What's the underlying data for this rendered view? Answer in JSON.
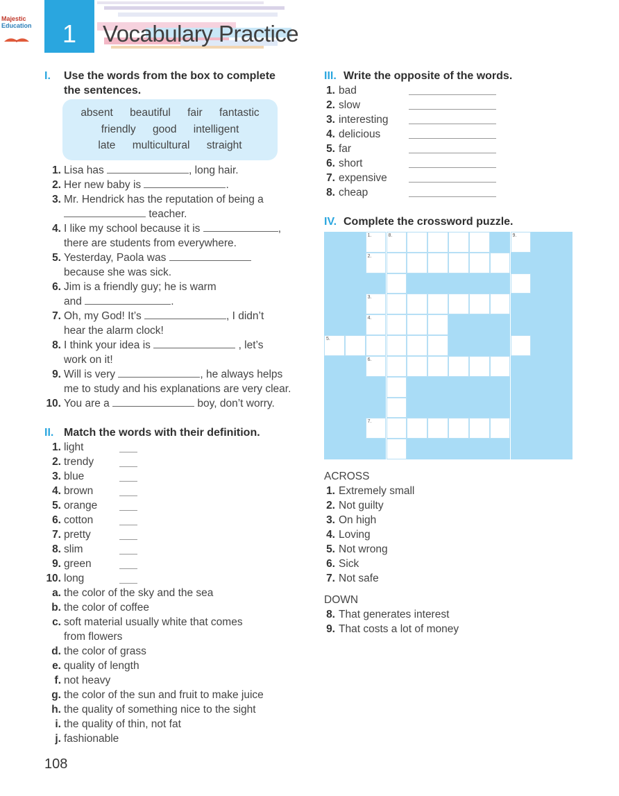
{
  "header": {
    "logo_line1": "Majestic",
    "logo_line2": "Education",
    "unit_number": "1",
    "title": "Vocabulary Practice",
    "accent_color": "#2aa6df"
  },
  "section1": {
    "roman": "I.",
    "heading": "Use the words from the box to complete the sentences.",
    "word_rows": [
      [
        "absent",
        "beautiful",
        "fair",
        "fantastic"
      ],
      [
        "friendly",
        "good",
        "intelligent"
      ],
      [
        "late",
        "multicultural",
        "straight"
      ]
    ],
    "sentences": [
      {
        "n": "1.",
        "a": "Lisa has",
        "b": ", long hair.",
        "c": ""
      },
      {
        "n": "2.",
        "a": "Her new baby is",
        "b": ".",
        "c": ""
      },
      {
        "n": "3.",
        "a": "Mr. Hendrick has the reputation of being a",
        "b": "teacher.",
        "c": ""
      },
      {
        "n": "4.",
        "a": "I like my school because it is",
        "b": ",",
        "c": "there are students from everywhere."
      },
      {
        "n": "5.",
        "a": "Yesterday, Paola was",
        "b": "",
        "c": "because she was sick."
      },
      {
        "n": "6.",
        "a": "Jim is a friendly guy; he is warm",
        "b": "and",
        "c": "."
      },
      {
        "n": "7.",
        "a": "Oh, my God! It’s",
        "b": ", I didn’t",
        "c": "hear the alarm clock!"
      },
      {
        "n": "8.",
        "a": "I think your idea is",
        "b": ", let’s",
        "c": "work on it!"
      },
      {
        "n": "9.",
        "a": "Will is very",
        "b": ", he always helps",
        "c": "me to study and his explanations are very clear."
      },
      {
        "n": "10.",
        "a": "You are a",
        "b": "boy, don’t worry.",
        "c": ""
      }
    ]
  },
  "section2": {
    "roman": "II.",
    "heading": "Match the words with their definition.",
    "words": [
      {
        "n": "1.",
        "w": "light"
      },
      {
        "n": "2.",
        "w": "trendy"
      },
      {
        "n": "3.",
        "w": "blue"
      },
      {
        "n": "4.",
        "w": "brown"
      },
      {
        "n": "5.",
        "w": "orange"
      },
      {
        "n": "6.",
        "w": "cotton"
      },
      {
        "n": "7.",
        "w": "pretty"
      },
      {
        "n": "8.",
        "w": "slim"
      },
      {
        "n": "9.",
        "w": "green"
      },
      {
        "n": "10.",
        "w": "long"
      }
    ],
    "definitions": [
      {
        "l": "a.",
        "t": "the color of the sky and the sea"
      },
      {
        "l": "b.",
        "t": "the color of coffee"
      },
      {
        "l": "c.",
        "t": "soft material usually white that comes",
        "t2": "from flowers"
      },
      {
        "l": "d.",
        "t": "the color of grass"
      },
      {
        "l": "e.",
        "t": "quality of length"
      },
      {
        "l": "f.",
        "t": "not heavy"
      },
      {
        "l": "g.",
        "t": "the color of the sun and fruit to make juice"
      },
      {
        "l": "h.",
        "t": "the quality of something nice to the sight"
      },
      {
        "l": "i.",
        "t": "the quality of thin, not fat"
      },
      {
        "l": "j.",
        "t": "fashionable"
      }
    ]
  },
  "section3": {
    "roman": "III.",
    "heading": "Write the opposite of the words.",
    "words": [
      {
        "n": "1.",
        "w": "bad"
      },
      {
        "n": "2.",
        "w": "slow"
      },
      {
        "n": "3.",
        "w": "interesting"
      },
      {
        "n": "4.",
        "w": "delicious"
      },
      {
        "n": "5.",
        "w": "far"
      },
      {
        "n": "6.",
        "w": "short"
      },
      {
        "n": "7.",
        "w": "expensive"
      },
      {
        "n": "8.",
        "w": "cheap"
      }
    ]
  },
  "section4": {
    "roman": "IV.",
    "heading": "Complete the crossword puzzle.",
    "grid_rows": [
      "##......#.",
      "##.......#",
      "###.#####.",
      "##.......#",
      "##....####",
      "......###.",
      "##.......#",
      "###.######",
      "###.######",
      "##.......#",
      "###.######"
    ],
    "clue_labels": [
      {
        "r": 0,
        "c": 2,
        "t": "1."
      },
      {
        "r": 0,
        "c": 3,
        "t": "8."
      },
      {
        "r": 0,
        "c": 9,
        "t": "9."
      },
      {
        "r": 1,
        "c": 2,
        "t": "2."
      },
      {
        "r": 3,
        "c": 2,
        "t": "3."
      },
      {
        "r": 4,
        "c": 2,
        "t": "4."
      },
      {
        "r": 5,
        "c": 0,
        "t": "5."
      },
      {
        "r": 6,
        "c": 2,
        "t": "6."
      },
      {
        "r": 9,
        "c": 2,
        "t": "7."
      }
    ],
    "across_title": "ACROSS",
    "across": [
      {
        "n": "1.",
        "t": "Extremely small"
      },
      {
        "n": "2.",
        "t": "Not guilty"
      },
      {
        "n": "3.",
        "t": "On high"
      },
      {
        "n": "4.",
        "t": "Loving"
      },
      {
        "n": "5.",
        "t": "Not wrong"
      },
      {
        "n": "6.",
        "t": "Sick"
      },
      {
        "n": "7.",
        "t": "Not safe"
      }
    ],
    "down_title": "DOWN",
    "down": [
      {
        "n": "8.",
        "t": "That generates interest"
      },
      {
        "n": "9.",
        "t": "That costs a lot of money"
      }
    ]
  },
  "page_number": "108"
}
